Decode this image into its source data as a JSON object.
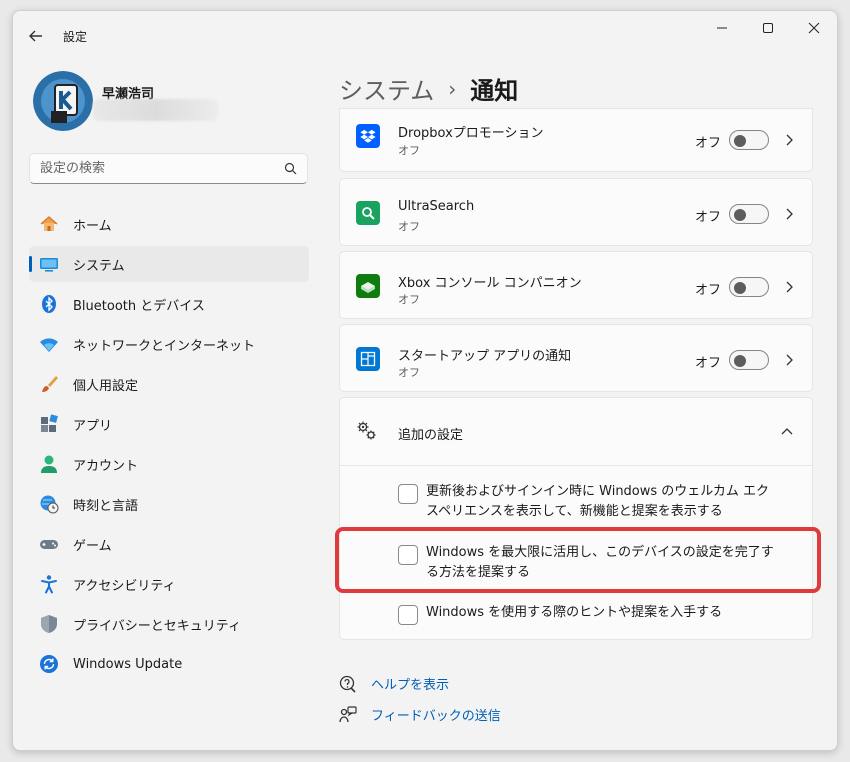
{
  "window": {
    "title": "設定"
  },
  "user": {
    "name": "早瀬浩司"
  },
  "search": {
    "placeholder": "設定の検索"
  },
  "sidebar": {
    "items": [
      {
        "label": "ホーム",
        "icon": "home-icon"
      },
      {
        "label": "システム",
        "icon": "system-icon",
        "active": true
      },
      {
        "label": "Bluetooth とデバイス",
        "icon": "bluetooth-icon"
      },
      {
        "label": "ネットワークとインターネット",
        "icon": "wifi-icon"
      },
      {
        "label": "個人用設定",
        "icon": "brush-icon"
      },
      {
        "label": "アプリ",
        "icon": "apps-icon"
      },
      {
        "label": "アカウント",
        "icon": "account-icon"
      },
      {
        "label": "時刻と言語",
        "icon": "globe-clock-icon"
      },
      {
        "label": "ゲーム",
        "icon": "gamepad-icon"
      },
      {
        "label": "アクセシビリティ",
        "icon": "accessibility-icon"
      },
      {
        "label": "プライバシーとセキュリティ",
        "icon": "shield-icon"
      },
      {
        "label": "Windows Update",
        "icon": "update-icon"
      }
    ]
  },
  "breadcrumb": {
    "parent": "システム",
    "separator": "›",
    "current": "通知"
  },
  "apps": [
    {
      "name": "Dropboxプロモーション",
      "status": "オフ",
      "toggle_label": "オフ",
      "icon": "dropbox-icon",
      "color": "#0061fe"
    },
    {
      "name": "UltraSearch",
      "status": "オフ",
      "toggle_label": "オフ",
      "icon": "ultrasearch-icon",
      "color": "#1aa260"
    },
    {
      "name": "Xbox コンソール コンパニオン",
      "status": "オフ",
      "toggle_label": "オフ",
      "icon": "xbox-icon",
      "color": "#107c10"
    },
    {
      "name": "スタートアップ アプリの通知",
      "status": "オフ",
      "toggle_label": "オフ",
      "icon": "startup-icon",
      "color": "#0078d4"
    }
  ],
  "extra_settings": {
    "title": "追加の設定",
    "options": [
      {
        "text": "更新後およびサインイン時に Windows のウェルカム エクスペリエンスを表示して、新機能と提案を表示する",
        "checked": false
      },
      {
        "text": "Windows を最大限に活用し、このデバイスの設定を完了する方法を提案する",
        "checked": false
      },
      {
        "text": "Windows を使用する際のヒントや提案を入手する",
        "checked": false
      }
    ]
  },
  "links": {
    "help": "ヘルプを表示",
    "feedback": "フィードバックの送信"
  },
  "colors": {
    "accent": "#005fb8",
    "highlight": "#e03a3a"
  }
}
